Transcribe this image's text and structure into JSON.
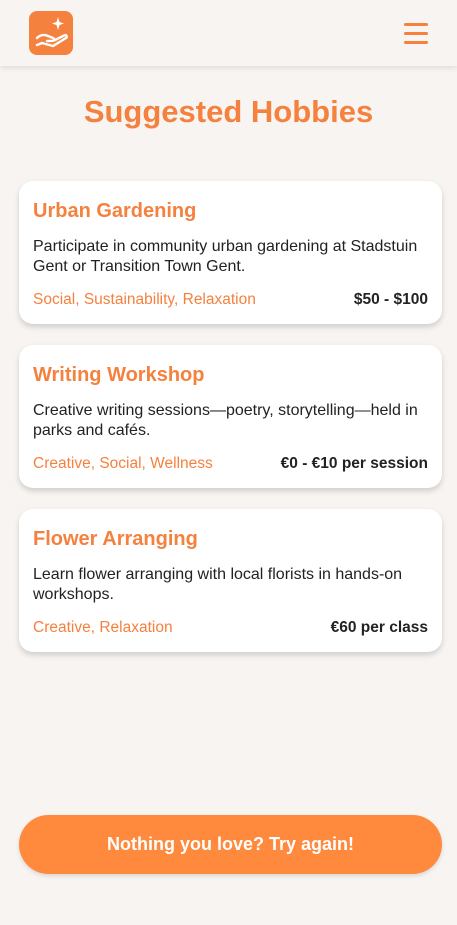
{
  "header": {
    "logo_icon": "hand-with-sparkle-icon",
    "menu_icon": "hamburger-menu-icon"
  },
  "page_title": "Suggested Hobbies",
  "hobbies": [
    {
      "title": "Urban Gardening",
      "description": "Participate in community urban gardening at Stadstuin Gent or Transition Town Gent.",
      "tags": "Social, Sustainability, Relaxation",
      "price": "$50 - $100"
    },
    {
      "title": "Writing Workshop",
      "description": "Creative writing sessions—poetry, storytelling—held in parks and cafés.",
      "tags": "Creative, Social, Wellness",
      "price": "€0 - €10 per session"
    },
    {
      "title": "Flower Arranging",
      "description": "Learn flower arranging with local florists in hands-on workshops.",
      "tags": "Creative, Relaxation",
      "price": "€60 per class"
    }
  ],
  "retry_button_label": "Nothing you love? Try again!",
  "colors": {
    "accent": "#f5813f",
    "background": "#f7f4f1",
    "card": "#ffffff",
    "text": "#222222"
  }
}
